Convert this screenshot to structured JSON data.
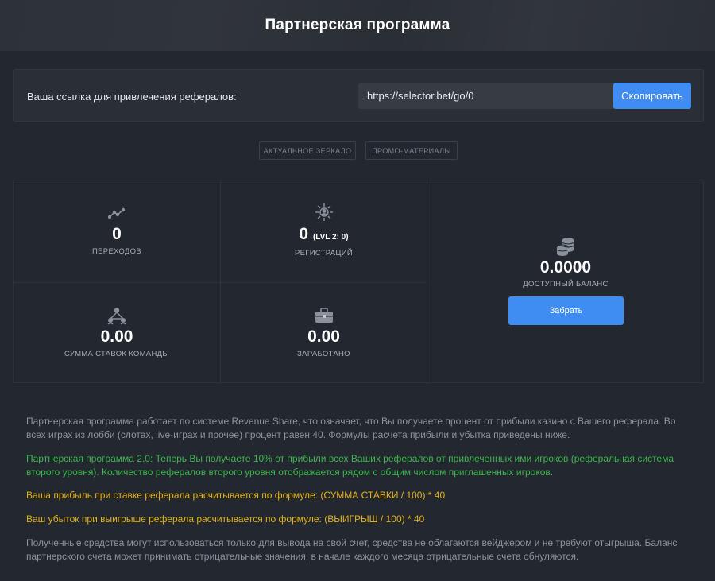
{
  "header": {
    "title": "Партнерская программа"
  },
  "referral": {
    "label": "Ваша ссылка для привлечения рефералов:",
    "link": "https://selector.bet/go/0",
    "copy_label": "Скопировать"
  },
  "tabs": [
    {
      "label": "АКТУАЛЬНОЕ ЗЕРКАЛО"
    },
    {
      "label": "ПРОМО-МАТЕРИАЛЫ"
    }
  ],
  "stats": {
    "clicks": {
      "value": "0",
      "label": "ПЕРЕХОДОВ",
      "icon": "chart-line-icon"
    },
    "registrations": {
      "value": "0",
      "sub": "(LVL 2: 0)",
      "label": "РЕГИСТРАЦИЙ",
      "icon": "user-network-icon"
    },
    "team_bets": {
      "value": "0.00",
      "label": "СУММА СТАВОК КОМАНДЫ",
      "icon": "team-hierarchy-icon"
    },
    "earned": {
      "value": "0.00",
      "label": "ЗАРАБОТАНО",
      "icon": "briefcase-icon"
    },
    "balance": {
      "value": "0.0000",
      "label": "ДОСТУПНЫЙ БАЛАНС",
      "icon": "coins-icon",
      "button": "Забрать"
    }
  },
  "info": {
    "p1": "Партнерская программа работает по системе Revenue Share, что означает, что Вы получаете процент от прибыли казино с Вашего реферала. Во всех играх из лобби (слотах, live-играх и прочее) процент равен 40. Формулы расчета прибыли и убытка приведены ниже.",
    "p2": "Партнерская программа 2.0: Теперь Вы получаете 10% от прибыли всех Ваших рефералов от привлеченных ими игроков (реферальная система второго уровня). Количество рефералов второго уровня отображается рядом с общим числом приглашенных игроков.",
    "p3": "Ваша прибыль при ставке реферала расчитывается по формуле: (СУММА СТАВКИ / 100) * 40",
    "p4": "Ваш убыток при выигрыше реферала расчитывается по формуле: (ВЫИГРЫШ / 100) * 40",
    "p5": "Полученные средства могут использоваться только для вывода на свой счет, средства не облагаются вейджером и не требуют отыгрыша. Баланс партнерского счета может принимать отрицательные значения, в начале каждого месяца отрицательные счета обнуляются."
  },
  "colors": {
    "accent": "#3f8cf2",
    "background": "#232830",
    "panel": "#2a2f37",
    "green_text": "#3bb54a",
    "yellow_text": "#e2b014"
  }
}
